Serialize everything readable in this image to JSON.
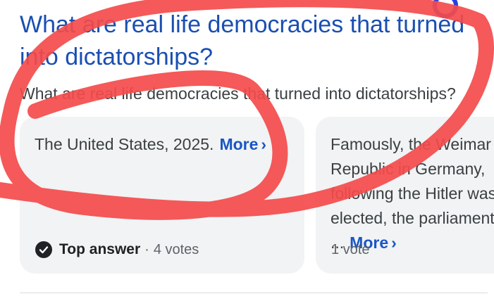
{
  "result": {
    "title": "What are real life democracies that turned into dictatorships?",
    "question": "What are real life democracies that turned into dictatorships?"
  },
  "cards": [
    {
      "text": "The United States, 2025.",
      "more_label": "More",
      "badge_label": "Top answer",
      "votes": "4 votes"
    },
    {
      "text": "Famously, the Weimar Republic in Germany, following the Hitler was elected, the parliament ...",
      "more_label": "More",
      "votes": "1 vote"
    }
  ],
  "annotation": {
    "color": "#f44b4b"
  },
  "colors": {
    "link": "#1a4fb2",
    "card_bg": "#f1f3f4"
  },
  "icons": {
    "chevron": "chevron-right-icon",
    "check": "check-circle-icon"
  }
}
